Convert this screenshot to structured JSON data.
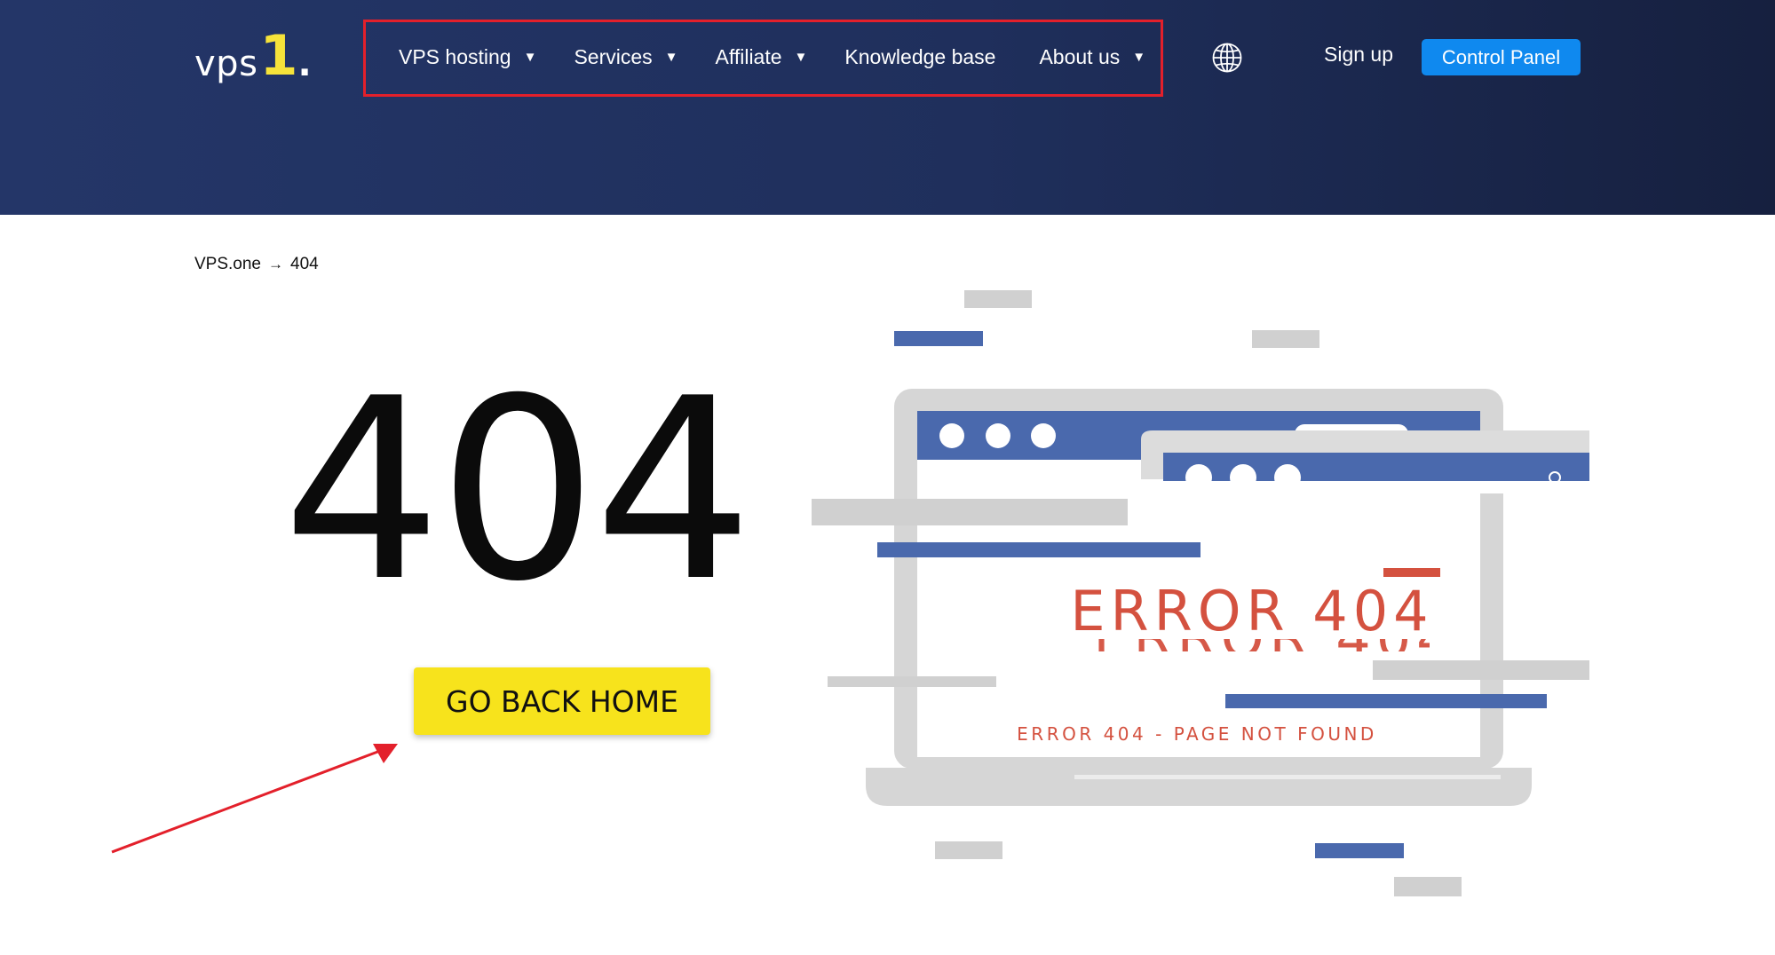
{
  "header": {
    "logo": {
      "text": "vps",
      "digit": "1",
      "dot": "."
    },
    "nav": [
      {
        "label": "VPS hosting",
        "has_dropdown": true
      },
      {
        "label": "Services",
        "has_dropdown": true
      },
      {
        "label": "Affiliate",
        "has_dropdown": true
      },
      {
        "label": "Knowledge base",
        "has_dropdown": false
      },
      {
        "label": "About us",
        "has_dropdown": true
      }
    ],
    "language_icon": "globe-icon",
    "signup_label": "Sign up",
    "control_panel_label": "Control Panel"
  },
  "breadcrumb": {
    "home": "VPS.one",
    "separator": "→",
    "current": "404"
  },
  "main": {
    "error_code": "404",
    "home_button_label": "GO BACK HOME"
  },
  "illustration": {
    "headline": "ERROR 404",
    "subline": "ERROR 404 - PAGE NOT FOUND"
  },
  "colors": {
    "header_bg": "#243668",
    "accent_blue": "#0f89ef",
    "button_yellow": "#f7e31c",
    "annotation_red": "#e3202b",
    "illustration_blue": "#4a69ad",
    "illustration_gray": "#d0d0d0",
    "illustration_red": "#d4513f"
  }
}
